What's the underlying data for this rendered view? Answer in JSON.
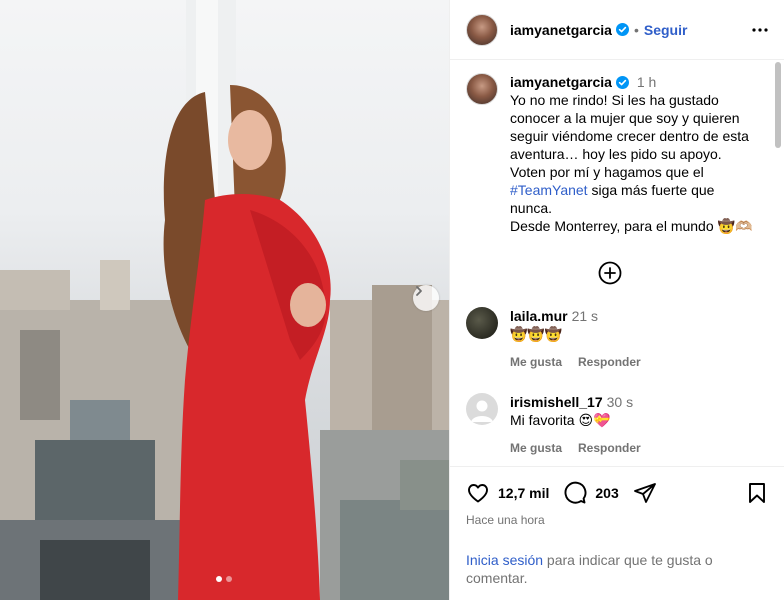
{
  "photo": {
    "next_icon": "chevron-right-icon",
    "carousel_count": 2,
    "carousel_active_index": 0
  },
  "header": {
    "username": "iamyanetgarcia",
    "verified_icon": "verified-badge-icon",
    "separator": "•",
    "follow_label": "Seguir",
    "more_icon": "more-options-icon"
  },
  "caption": {
    "username": "iamyanetgarcia",
    "time": "1 h",
    "text_part1": "Yo no me rindo! Si les ha gustado conocer a la mujer que soy y quieren seguir viéndome crecer dentro de esta aventura… hoy les pido su apoyo. Voten por mí y hagamos que el ",
    "hashtag": "#TeamYanet",
    "text_part2": " siga más fuerte que nunca.\nDesde Monterrey, para el mundo 🤠🫶🏼"
  },
  "load_more_icon": "plus-circle-icon",
  "comments": [
    {
      "username": "laila.mur",
      "time": "21 s",
      "text": "🤠🤠🤠",
      "like_label": "Me gusta",
      "reply_label": "Responder"
    },
    {
      "username": "irismishell_17",
      "time": "30 s",
      "text": "Mi favorita 😍💝",
      "like_label": "Me gusta",
      "reply_label": "Responder"
    }
  ],
  "actions": {
    "like_icon": "heart-icon",
    "likes_count": "12,7 mil",
    "comment_icon": "comment-icon",
    "comments_count": "203",
    "share_icon": "share-icon",
    "save_icon": "bookmark-icon",
    "posted": "Hace una hora"
  },
  "login": {
    "link": "Inicia sesión",
    "rest": " para indicar que te gusta o comentar."
  }
}
